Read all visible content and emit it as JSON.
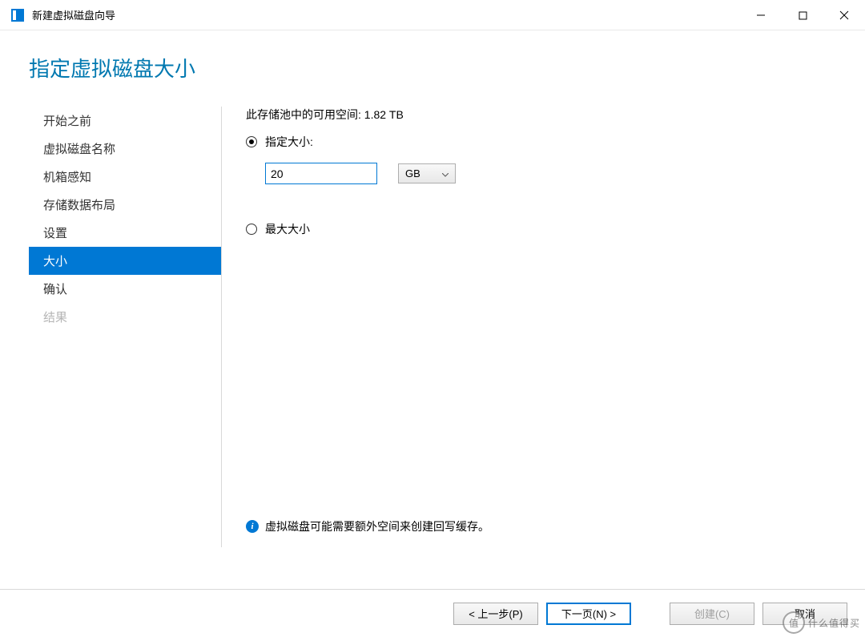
{
  "window": {
    "title": "新建虚拟磁盘向导"
  },
  "page": {
    "heading": "指定虚拟磁盘大小"
  },
  "sidebar": {
    "items": [
      {
        "label": "开始之前",
        "state": "normal"
      },
      {
        "label": "虚拟磁盘名称",
        "state": "normal"
      },
      {
        "label": "机箱感知",
        "state": "normal"
      },
      {
        "label": "存储数据布局",
        "state": "normal"
      },
      {
        "label": "设置",
        "state": "normal"
      },
      {
        "label": "大小",
        "state": "active"
      },
      {
        "label": "确认",
        "state": "normal"
      },
      {
        "label": "结果",
        "state": "disabled"
      }
    ]
  },
  "main": {
    "available_space_label": "此存储池中的可用空间: 1.82 TB",
    "radio_specify": "指定大小:",
    "radio_max": "最大大小",
    "size_value": "20",
    "unit_value": "GB",
    "hint": "虚拟磁盘可能需要额外空间来创建回写缓存。"
  },
  "footer": {
    "prev": "< 上一步(P)",
    "next": "下一页(N) >",
    "create": "创建(C)",
    "cancel": "取消"
  },
  "watermark": {
    "badge": "值",
    "text": "什么值得买"
  }
}
